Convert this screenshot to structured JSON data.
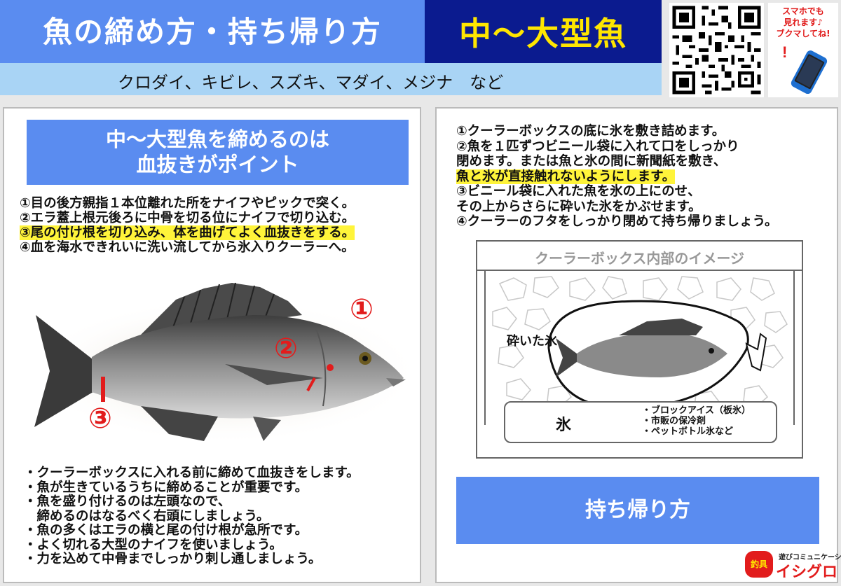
{
  "header": {
    "title": "魚の締め方・持ち帰り方",
    "subtitle": "中〜大型魚",
    "species": "クロダイ、キビレ、スズキ、マダイ、メジナ　など",
    "phone_note": [
      "スマホでも",
      "見れます♪",
      "ブクマしてね!"
    ],
    "phone_alert": "!"
  },
  "left": {
    "banner": [
      "中〜大型魚を締めるのは",
      "血抜きがポイント"
    ],
    "steps": [
      "①目の後方親指１本位離れた所をナイフやピックで突く。",
      "②エラ蓋上根元後ろに中骨を切る位にナイフで切り込む。",
      "③尾の付け根を切り込み、体を曲げてよく血抜きをする。",
      "④血を海水できれいに洗い流してから氷入りクーラーへ。"
    ],
    "markers": [
      "①",
      "②",
      "③"
    ],
    "bullets": [
      "・クーラーボックスに入れる前に締めて血抜きをします。",
      "・魚が生きているうちに締めることが重要です。",
      "・魚を盛り付けるのは左頭なので、",
      "　締めるのはなるべく右頭にしましょう。",
      "・魚の多くはエラの横と尾の付け根が急所です。",
      "・よく切れる大型のナイフを使いましょう。",
      "・力を込めて中骨までしっかり刺し通しましょう。"
    ]
  },
  "right": {
    "steps": [
      "①クーラーボックスの底に氷を敷き詰めます。",
      "②魚を１匹ずつビニール袋に入れて口をしっかり",
      "閉めます。または魚と氷の間に新聞紙を敷き、",
      "魚と氷が直接触れないようにします。",
      "③ビニール袋に入れた魚を氷の上にのせ、",
      "その上からさらに砕いた氷をかぶせます。",
      "④クーラーのフタをしっかり閉めて持ち帰りましょう。"
    ],
    "cooler_title": "クーラーボックス内部のイメージ",
    "crushed_ice": "砕いた氷",
    "ice_label": "氷",
    "ice_items": [
      "・ブロックアイス（板氷）",
      "・市販の保冷剤",
      "・ペットボトル氷など"
    ],
    "banner": "持ち帰り方"
  },
  "logo": {
    "tagline": "遊びコミュニケーション",
    "name": "イシグロ",
    "mark": "釣具"
  },
  "colors": {
    "title_blue": "#5a8cf0",
    "navy": "#0b1b8f",
    "yellow": "#ffe600",
    "light_blue": "#a9d4f5",
    "highlight": "#fff43a",
    "red": "#e21c1c"
  }
}
